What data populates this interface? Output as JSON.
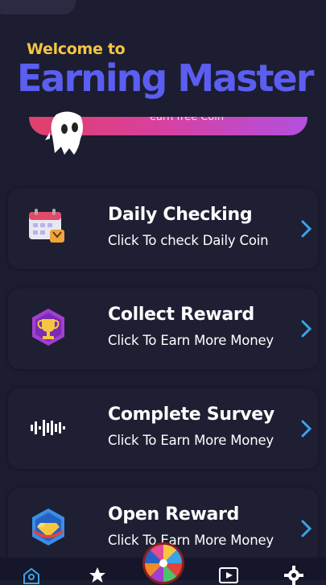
{
  "header": {
    "welcome_text": "Welcome to",
    "app_title": "Earning Master",
    "banner_text": "earn free Coin"
  },
  "colors": {
    "background": "#1c1d31",
    "welcome": "#f4c542",
    "title": "#5b5ef0",
    "chevron": "#3ba3e8",
    "nav_active": "#3ba3e8"
  },
  "cards": [
    {
      "title": "Daily Checking",
      "subtitle": "Click To check Daily Coin",
      "icon": "calendar-icon"
    },
    {
      "title": "Collect Reward",
      "subtitle": "Click To Earn More Money",
      "icon": "trophy-icon"
    },
    {
      "title": "Complete Survey",
      "subtitle": "Click To Earn More Money",
      "icon": "audio-wave-icon"
    },
    {
      "title": "Open Reward",
      "subtitle": "Click To Earn More Money",
      "icon": "diamond-icon"
    }
  ],
  "bottom_nav": {
    "items": [
      "home-icon",
      "star-icon",
      "spin-wheel-icon",
      "video-play-icon",
      "gear-icon"
    ],
    "active": "home-icon"
  }
}
